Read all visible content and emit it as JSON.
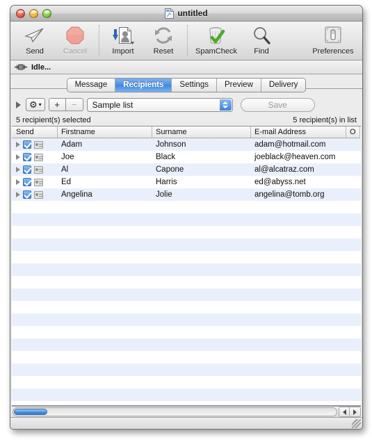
{
  "window": {
    "title": "untitled",
    "doc_icon": "document-icon",
    "close_button": "close-button",
    "minimize_button": "minimize-button",
    "zoom_button": "zoom-button"
  },
  "toolbar": {
    "items": [
      {
        "label": "Send",
        "icon": "paper-plane-icon",
        "disabled": false,
        "wide": false
      },
      {
        "label": "Cancel",
        "icon": "stop-octagon-icon",
        "disabled": true,
        "wide": false
      },
      {
        "label": "Import",
        "icon": "import-contact-icon",
        "disabled": false,
        "wide": false
      },
      {
        "label": "Reset",
        "icon": "refresh-arrows-icon",
        "disabled": false,
        "wide": false
      },
      {
        "label": "SpamCheck",
        "icon": "trash-check-icon",
        "disabled": false,
        "wide": true
      },
      {
        "label": "Find",
        "icon": "magnifier-icon",
        "disabled": false,
        "wide": false
      },
      {
        "label": "Preferences",
        "icon": "toggle-switch-icon",
        "disabled": false,
        "wide": true
      }
    ]
  },
  "status": {
    "indicator_icon": "network-activity-icon",
    "text": "Idle..."
  },
  "tabs": [
    {
      "label": "Message",
      "active": false
    },
    {
      "label": "Recipients",
      "active": true
    },
    {
      "label": "Settings",
      "active": false
    },
    {
      "label": "Preview",
      "active": false
    },
    {
      "label": "Delivery",
      "active": false
    }
  ],
  "controls": {
    "disclosure_icon": "disclosure-triangle-icon",
    "gear_label": "⚙",
    "gear_caret": "▾",
    "add_label": "+",
    "remove_label": "−",
    "list_value": "Sample list",
    "save_label": "Save"
  },
  "counts": {
    "selected": "5 recipient(s) selected",
    "in_list": "5 recipient(s) in list"
  },
  "table": {
    "columns": [
      "Send",
      "Firstname",
      "Surname",
      "E-mail Address",
      "O"
    ],
    "rows": [
      {
        "checked": true,
        "firstname": "Adam",
        "surname": "Johnson",
        "email": "adam@hotmail.com"
      },
      {
        "checked": true,
        "firstname": "Joe",
        "surname": "Black",
        "email": "joeblack@heaven.com"
      },
      {
        "checked": true,
        "firstname": "Al",
        "surname": "Capone",
        "email": "al@alcatraz.com"
      },
      {
        "checked": true,
        "firstname": "Ed",
        "surname": "Harris",
        "email": "ed@abyss.net"
      },
      {
        "checked": true,
        "firstname": "Angelina",
        "surname": "Jolie",
        "email": "angelina@tomb.org"
      }
    ],
    "empty_row_count": 16
  },
  "scrollbar": {
    "left_arrow": "scroll-left-arrow",
    "right_arrow": "scroll-right-arrow",
    "thumb": "scroll-thumb"
  },
  "colors": {
    "accent_blue": "#3f86de",
    "row_stripe": "#eaf0fb",
    "window_chrome": "#ececec"
  }
}
